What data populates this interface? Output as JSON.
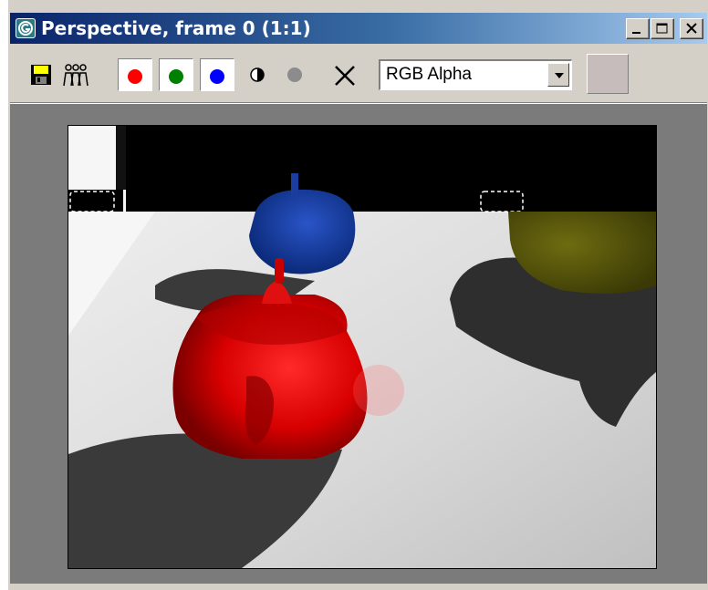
{
  "window": {
    "title": "Perspective, frame 0 (1:1)"
  },
  "title_buttons": [
    {
      "name": "minimize-button",
      "icon": "minimize-icon"
    },
    {
      "name": "maximize-button",
      "icon": "maximize-icon"
    },
    {
      "name": "close-button",
      "icon": "close-icon"
    }
  ],
  "toolbar": {
    "icons": [
      "save-icon",
      "clone-window-icon",
      "red-channel-icon",
      "green-channel-icon",
      "blue-channel-icon",
      "monochrome-icon",
      "alpha-channel-icon",
      "clear-icon"
    ],
    "channel_dropdown": {
      "value": "RGB Alpha"
    },
    "swatch_color": "#c6bcbc"
  },
  "colors": {
    "title_gradient_start": "#0a246a",
    "title_gradient_end": "#a6caf0",
    "chrome": "#d4d0c8",
    "viewport_background": "#7b7b7b",
    "red_channel": "#ff0000",
    "green_channel": "#008000",
    "blue_channel": "#0000ff"
  },
  "render": {
    "description_icon": "rendered-image",
    "objects": [
      "red-teapot",
      "blue-teapot",
      "olive-teapot"
    ]
  }
}
